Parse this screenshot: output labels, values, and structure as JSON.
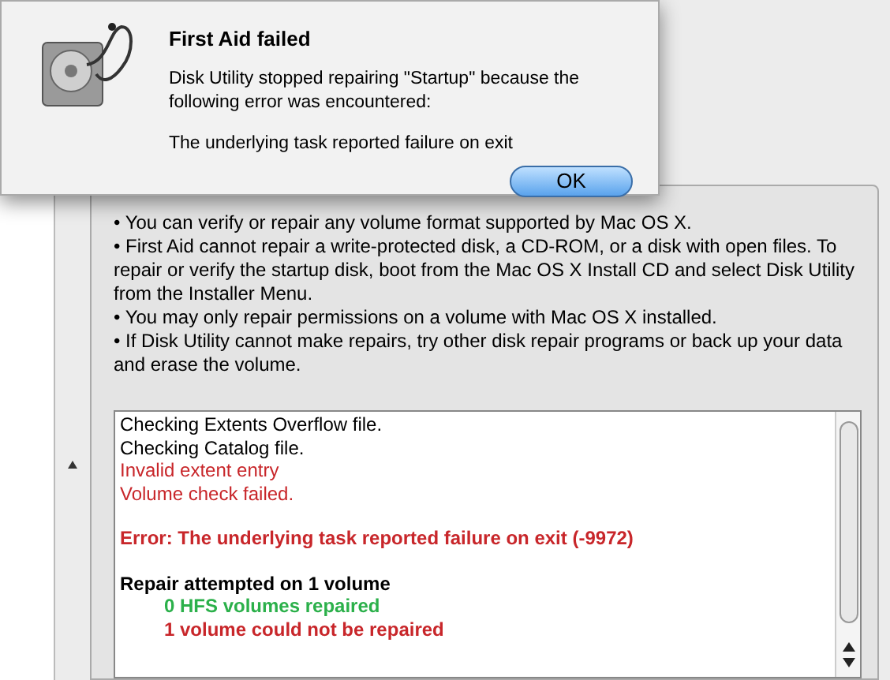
{
  "dialog": {
    "title": "First Aid failed",
    "message": "Disk Utility stopped repairing \"Startup\" because the following error was encountered:",
    "detail": "The underlying task reported failure on exit",
    "button": "OK"
  },
  "info_bullets": [
    "• You can verify or repair any volume format supported by Mac OS X.",
    "• First Aid cannot repair a write-protected disk, a CD-ROM, or a disk with open files. To repair or verify the startup disk, boot from the Mac OS X Install CD and select Disk Utility from the Installer Menu.",
    "• You may only repair permissions on a volume with Mac OS X installed.",
    "• If Disk Utility cannot make repairs, try other disk repair programs or back up your data and erase the volume."
  ],
  "log": [
    {
      "text": "Checking Extents Overflow file.",
      "kind": "plain"
    },
    {
      "text": "Checking Catalog file.",
      "kind": "plain"
    },
    {
      "text": "Invalid extent entry",
      "kind": "warning"
    },
    {
      "text": "Volume check failed.",
      "kind": "warning"
    },
    {
      "text": "Error: The underlying task reported failure on exit (-9972)",
      "kind": "error"
    },
    {
      "text": "Repair attempted on 1 volume",
      "kind": "heading"
    },
    {
      "text": "0 HFS volumes repaired",
      "kind": "success"
    },
    {
      "text": "1 volume could not be repaired",
      "kind": "failure"
    }
  ]
}
